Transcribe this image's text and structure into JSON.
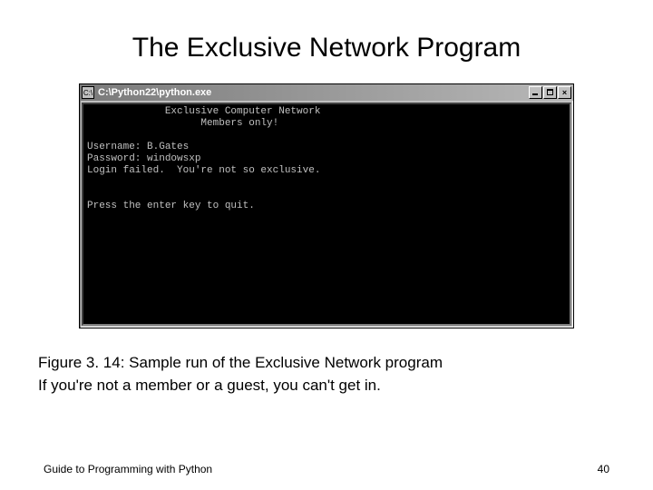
{
  "slide": {
    "title": "The Exclusive Network Program",
    "caption_label": "Figure 3. 14: Sample run of the Exclusive Network program",
    "caption_desc": "If you're not a member or a guest, you can't get in.",
    "footer_text": "Guide to Programming with Python",
    "page_number": "40"
  },
  "window": {
    "title": "C:\\Python22\\python.exe",
    "icon_glyph": "C:\\",
    "minimize_label": "_",
    "maximize_label": "□",
    "close_label": "×",
    "console_text": "             Exclusive Computer Network\n                   Members only!\n\nUsername: B.Gates\nPassword: windowsxp\nLogin failed.  You're not so exclusive.\n\n\nPress the enter key to quit."
  }
}
